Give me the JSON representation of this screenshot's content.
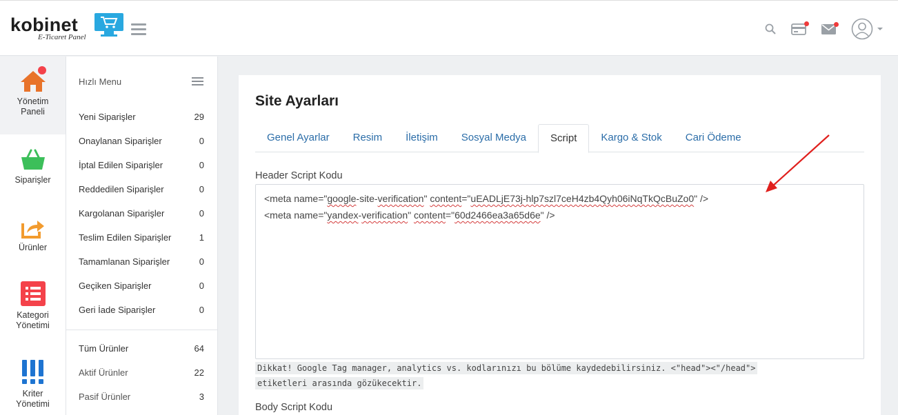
{
  "header": {
    "logo_text": "kobinet",
    "logo_subtitle": "E-Ticaret Panel",
    "icons": [
      "search-icon",
      "card-icon",
      "mail-icon",
      "user-avatar-icon"
    ]
  },
  "sidebar": {
    "items": [
      {
        "label": "Yönetim Paneli",
        "icon": "home-icon",
        "color": "#e8732a"
      },
      {
        "label": "Siparişler",
        "icon": "basket-icon",
        "color": "#3cbf5a"
      },
      {
        "label": "Ürünler",
        "icon": "share-icon",
        "color": "#f29b2e"
      },
      {
        "label": "Kategori Yönetimi",
        "icon": "list-icon",
        "color": "#f4424a"
      },
      {
        "label": "Kriter Yönetimi",
        "icon": "grid-icon",
        "color": "#1e74d1"
      }
    ]
  },
  "quick_menu": {
    "title": "Hızlı Menu",
    "orders": [
      {
        "label": "Yeni Siparişler",
        "count": "29"
      },
      {
        "label": "Onaylanan Siparişler",
        "count": "0"
      },
      {
        "label": "İptal Edilen Siparişler",
        "count": "0"
      },
      {
        "label": "Reddedilen Siparişler",
        "count": "0"
      },
      {
        "label": "Kargolanan Siparişler",
        "count": "0"
      },
      {
        "label": "Teslim Edilen Siparişler",
        "count": "1"
      },
      {
        "label": "Tamamlanan Siparişler",
        "count": "0"
      },
      {
        "label": "Geçiken Siparişler",
        "count": "0"
      },
      {
        "label": "Geri İade Siparişler",
        "count": "0"
      }
    ],
    "products": [
      {
        "label": "Tüm Ürünler",
        "count": "64"
      },
      {
        "label": "Aktif Ürünler",
        "count": "22"
      },
      {
        "label": "Pasif Ürünler",
        "count": "3"
      }
    ]
  },
  "main": {
    "title": "Site Ayarları",
    "tabs": [
      "Genel Ayarlar",
      "Resim",
      "İletişim",
      "Sosyal Medya",
      "Script",
      "Kargo & Stok",
      "Cari Ödeme"
    ],
    "active_tab": "Script",
    "header_script_label": "Header Script Kodu",
    "header_script_lines": [
      "<meta name=\"google-site-verification\" content=\"uEADLjE73j-hlp7szl7ceH4zb4Qyh06iNqTkQcBuZo0\" />",
      "<meta name=\"yandex-verification\" content=\"60d2466ea3a65d6e\" />"
    ],
    "hint_line1": "Dikkat! Google Tag manager, analytics vs. kodlarınızı bu bölüme kaydedebilirsiniz. <\"head\"><\"/head\">",
    "hint_line2": "etiketleri arasında gözükecektir.",
    "body_script_label": "Body Script Kodu"
  },
  "colors": {
    "accent": "#2b6da8",
    "annotation_arrow": "#e0201d",
    "notification": "#ef3b3b"
  }
}
